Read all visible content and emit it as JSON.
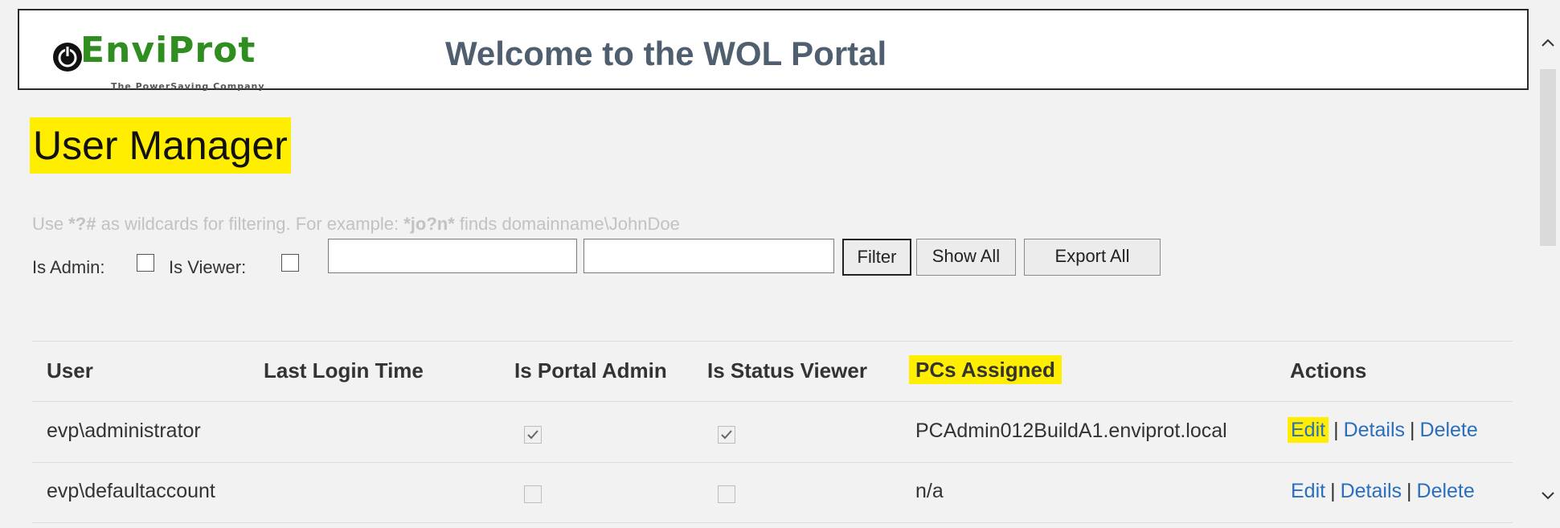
{
  "header": {
    "logo_name": "EnviProt",
    "logo_tagline": "The PowerSaving Company",
    "welcome": "Welcome to the WOL Portal"
  },
  "page": {
    "title": "User Manager"
  },
  "filter": {
    "hint_prefix": "Use ",
    "hint_wild": "*?#",
    "hint_middle": " as wildcards for filtering. For example: ",
    "hint_example": "*jo?n*",
    "hint_suffix": " finds domainname\\JohnDoe",
    "is_admin_label": "Is Admin:",
    "is_viewer_label": "Is Viewer:",
    "is_admin_checked": false,
    "is_viewer_checked": false,
    "text1_value": "",
    "text2_value": "",
    "filter_button": "Filter",
    "show_all_button": "Show All",
    "export_all_button": "Export All"
  },
  "table": {
    "columns": [
      "User",
      "Last Login Time",
      "Is Portal Admin",
      "Is Status Viewer",
      "PCs Assigned",
      "Actions"
    ],
    "rows": [
      {
        "user": "evp\\administrator",
        "last_login": "",
        "is_portal_admin": true,
        "is_status_viewer": true,
        "pcs_assigned": "PCAdmin012BuildA1.enviprot.local",
        "actions": {
          "edit": "Edit",
          "details": "Details",
          "delete": "Delete",
          "sep": "|"
        }
      },
      {
        "user": "evp\\defaultaccount",
        "last_login": "",
        "is_portal_admin": false,
        "is_status_viewer": false,
        "pcs_assigned": "n/a",
        "actions": {
          "edit": "Edit",
          "details": "Details",
          "delete": "Delete",
          "sep": "|"
        }
      }
    ]
  },
  "colors": {
    "highlight": "#ffee00",
    "link": "#2a6ebd",
    "logo_green": "#2f8e1f",
    "welcome_text": "#4f5f6f"
  }
}
